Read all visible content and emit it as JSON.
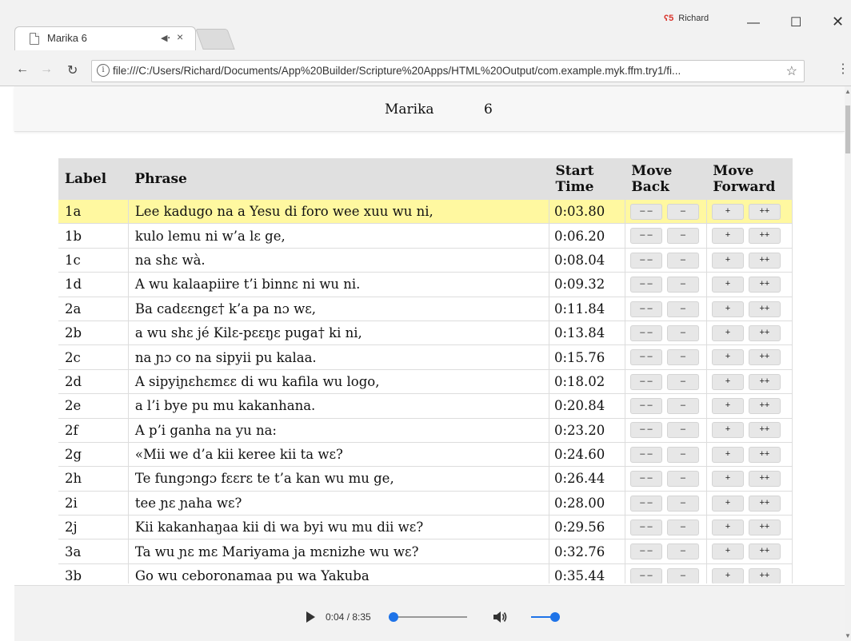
{
  "browser": {
    "tab_title": "Marika 6",
    "tab_sound_icon": "speaker-icon",
    "tab_close": "×",
    "profile_name": "Richard",
    "url": "file:///C:/Users/Richard/Documents/App%20Builder/Scripture%20Apps/HTML%20Output/com.example.myk.ffm.try1/fi..."
  },
  "page": {
    "book": "Marika",
    "chapter": "6"
  },
  "table": {
    "headers": {
      "label": "Label",
      "phrase": "Phrase",
      "start_time": "Start Time",
      "move_back": "Move Back",
      "move_forward": "Move Forward"
    },
    "button_labels": {
      "back_big": "– –",
      "back": "–",
      "forward": "+",
      "forward_big": "++"
    },
    "rows": [
      {
        "label": "1a",
        "phrase": "Lee kadugo na a Yesu di foro wee xuu wu ni,",
        "time": "0:03.80",
        "highlight": true
      },
      {
        "label": "1b",
        "phrase": "kulo lemu ni w’a lɛ ge,",
        "time": "0:06.20"
      },
      {
        "label": "1c",
        "phrase": "na shɛ wà.",
        "time": "0:08.04"
      },
      {
        "label": "1d",
        "phrase": "A wu kalaapiire t’i binnɛ ni wu ni.",
        "time": "0:09.32"
      },
      {
        "label": "2a",
        "phrase": "Ba cadɛɛngɛ† k’a pa nɔ wɛ,",
        "time": "0:11.84"
      },
      {
        "label": "2b",
        "phrase": "a wu shɛ jé Kilɛ-pɛɛŋɛ puga† ki ni,",
        "time": "0:13.84"
      },
      {
        "label": "2c",
        "phrase": "na ɲɔ co na sipyii pu kalaa.",
        "time": "0:15.76"
      },
      {
        "label": "2d",
        "phrase": "A sipyiɲɛhɛmɛɛ di wu kafila wu logo,",
        "time": "0:18.02"
      },
      {
        "label": "2e",
        "phrase": "a l’i bye pu mu kakanhana.",
        "time": "0:20.84"
      },
      {
        "label": "2f",
        "phrase": "A p’i ganha na yu na:",
        "time": "0:23.20"
      },
      {
        "label": "2g",
        "phrase": "«Mii we d’a kii keree kii ta wɛ?",
        "time": "0:24.60"
      },
      {
        "label": "2h",
        "phrase": "Te fungɔngɔ fɛɛrɛ te t’a kan wu mu ge,",
        "time": "0:26.44"
      },
      {
        "label": "2i",
        "phrase": "tee ɲɛ ɲaha wɛ?",
        "time": "0:28.00"
      },
      {
        "label": "2j",
        "phrase": "Kii kakanhaŋaa kii di wa byi wu mu dii wɛ?",
        "time": "0:29.56"
      },
      {
        "label": "3a",
        "phrase": "Ta wu ɲɛ mɛ Mariyama ja mɛnizhe wu wɛ?",
        "time": "0:32.76"
      },
      {
        "label": "3b",
        "phrase": "Go wu ceboronamaa pu wa Yakuba",
        "time": "0:35.44"
      }
    ]
  },
  "audio": {
    "time_display": "0:04 / 8:35",
    "progress_fraction": 0.008,
    "volume_fraction": 1.0
  }
}
